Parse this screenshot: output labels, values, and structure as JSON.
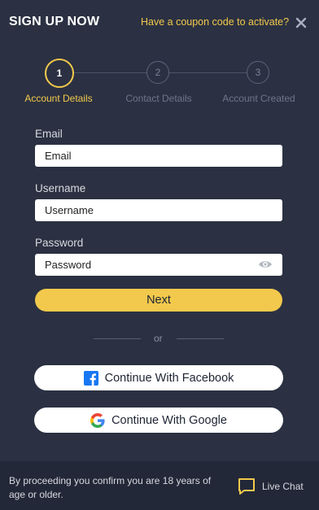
{
  "header": {
    "title": "SIGN UP NOW",
    "coupon_link": "Have a coupon code to activate?"
  },
  "stepper": {
    "steps": [
      {
        "number": "1",
        "label": "Account Details",
        "active": true
      },
      {
        "number": "2",
        "label": "Contact Details",
        "active": false
      },
      {
        "number": "3",
        "label": "Account Created",
        "active": false
      }
    ]
  },
  "form": {
    "email": {
      "label": "Email",
      "placeholder": "Email",
      "value": ""
    },
    "username": {
      "label": "Username",
      "placeholder": "Username",
      "value": ""
    },
    "password": {
      "label": "Password",
      "placeholder": "Password",
      "value": ""
    },
    "next_label": "Next"
  },
  "divider": {
    "text": "or"
  },
  "social": {
    "facebook_label": "Continue With Facebook",
    "google_label": "Continue With Google"
  },
  "footer": {
    "disclaimer": "By proceeding you confirm you are 18 years of age or older.",
    "live_chat_label": "Live Chat"
  },
  "colors": {
    "background": "#2b3142",
    "accent": "#f2c94c",
    "footer_bg": "#232838",
    "facebook_blue": "#1877f2"
  },
  "icons": {
    "close": "close-icon",
    "eye": "eye-icon",
    "facebook": "facebook-icon",
    "google": "google-icon",
    "chat": "chat-bubble-icon"
  }
}
